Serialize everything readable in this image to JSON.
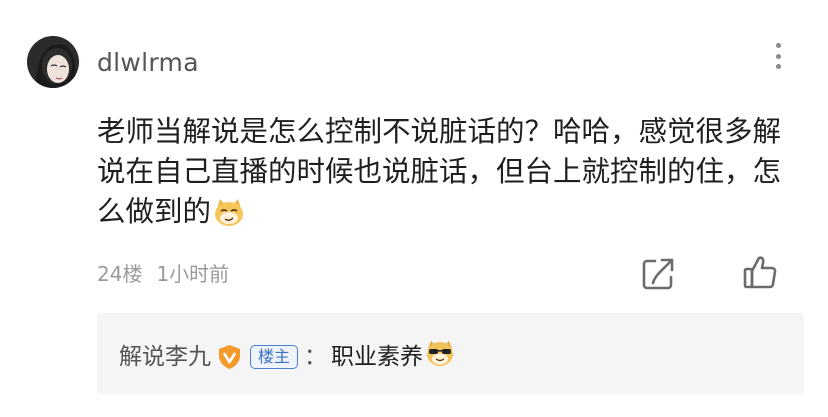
{
  "comment": {
    "username": "dlwlrma",
    "text": "老师当解说是怎么控制不说脏话的？哈哈，感觉很多解说在自己直播的时候也说脏话，但台上就控制的住，怎么做到的",
    "emoji_icon": "smirk-cat-face-emoji",
    "floor": "24楼",
    "time": "1小时前",
    "more_icon": "more-vertical-icon",
    "share_icon": "share-icon",
    "like_icon": "thumbs-up-icon"
  },
  "reply": {
    "author": "解说李九",
    "verified_icon": "verified-shield-icon",
    "verified_color": "#f39a2b",
    "op_badge": "楼主",
    "op_badge_color": "#4a7fd6",
    "colon": "：",
    "text": "职业素养",
    "emoji_icon": "cool-sunglasses-dog-emoji"
  }
}
